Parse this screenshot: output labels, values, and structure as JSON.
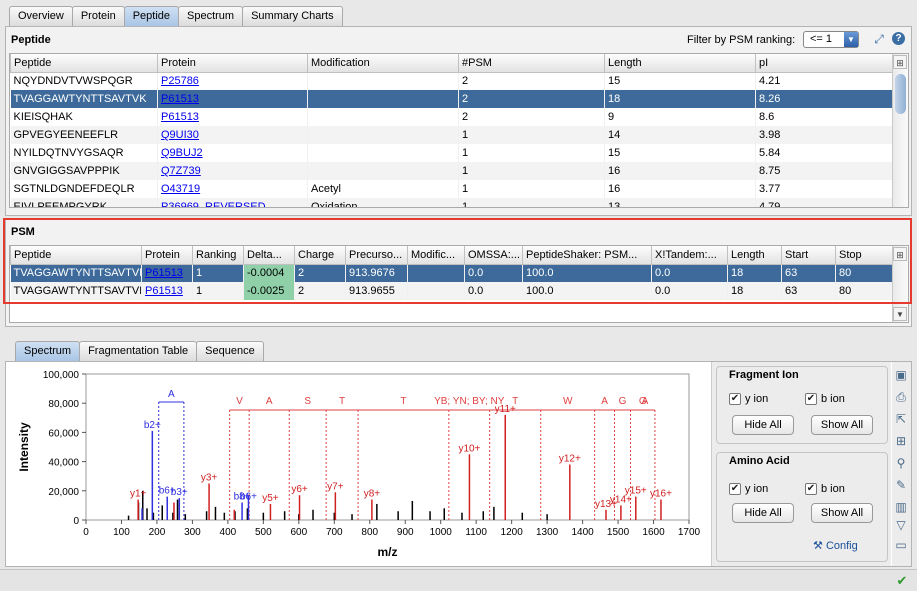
{
  "top_tabs": [
    "Overview",
    "Protein",
    "Peptide",
    "Spectrum",
    "Summary Charts"
  ],
  "peptide": {
    "title": "Peptide",
    "filter_label": "Filter by PSM ranking:",
    "filter_value": "<= 1",
    "columns": [
      "Peptide",
      "Protein",
      "Modification",
      "#PSM",
      "Length",
      "pI"
    ],
    "rows": [
      [
        "NQYDNDVTVWSPQGR",
        "P25786",
        "",
        "2",
        "15",
        "4.21"
      ],
      [
        "TVAGGAWTYNTTSAVTVK",
        "P61513",
        "",
        "2",
        "18",
        "8.26"
      ],
      [
        "KIEISQHAK",
        "P61513",
        "",
        "2",
        "9",
        "8.6"
      ],
      [
        "GPVEGYEENEEFLR",
        "Q9UI30",
        "",
        "1",
        "14",
        "3.98"
      ],
      [
        "NYILDQTNVYGSAQR",
        "Q9BUJ2",
        "",
        "1",
        "15",
        "5.84"
      ],
      [
        "GNVGIGGSAVPPPIK",
        "Q7Z739",
        "",
        "1",
        "16",
        "8.75"
      ],
      [
        "SGTNLDGNDEFDEQLR",
        "O43719",
        "Acetyl",
        "1",
        "16",
        "3.77"
      ],
      [
        "EIVLPEEMPGYRK",
        "P36969_REVERSED",
        "Oxidation",
        "1",
        "13",
        "4.79"
      ]
    ]
  },
  "psm": {
    "title": "PSM",
    "columns": [
      "Peptide",
      "Protein",
      "Ranking",
      "Delta...",
      "Charge",
      "Precurso...",
      "Modific...",
      "OMSSA:...",
      "PeptideShaker: PSM...",
      "X!Tandem:...",
      "Length",
      "Start",
      "Stop"
    ],
    "rows": [
      [
        "TVAGGAWTYNTTSAVTVK",
        "P61513",
        "1",
        "-0.0004",
        "2",
        "913.9676",
        "",
        "0.0",
        "100.0",
        "0.0",
        "18",
        "63",
        "80"
      ],
      [
        "TVAGGAWTYNTTSAVTVK",
        "P61513",
        "1",
        "-0.0025",
        "2",
        "913.9655",
        "",
        "0.0",
        "100.0",
        "0.0",
        "18",
        "63",
        "80"
      ]
    ]
  },
  "bottom_tabs": [
    "Spectrum",
    "Fragmentation Table",
    "Sequence"
  ],
  "fragment_ion": {
    "title": "Fragment Ion",
    "y_label": "y ion",
    "b_label": "b ion",
    "hide": "Hide All",
    "show": "Show All"
  },
  "amino_acid": {
    "title": "Amino Acid",
    "y_label": "y ion",
    "b_label": "b ion",
    "hide": "Hide All",
    "show": "Show All",
    "config": "Config"
  },
  "chart_data": {
    "type": "bar",
    "xlabel": "m/z",
    "ylabel": "Intensity",
    "xlim": [
      0,
      1700
    ],
    "ylim": [
      0,
      100000
    ],
    "xticks": [
      0,
      100,
      200,
      300,
      400,
      500,
      600,
      700,
      800,
      900,
      1000,
      1100,
      1200,
      1300,
      1400,
      1500,
      1600,
      1700
    ],
    "yticks": [
      0,
      20000,
      40000,
      60000,
      80000,
      100000
    ],
    "ytick_labels": [
      "0",
      "20,000",
      "40,000",
      "60,000",
      "80,000",
      "100,000"
    ],
    "series": [
      {
        "color": "#000000",
        "peaks": [
          [
            120,
            3000
          ],
          [
            148,
            12000
          ],
          [
            160,
            20000
          ],
          [
            172,
            8000
          ],
          [
            190,
            5000
          ],
          [
            215,
            10000
          ],
          [
            245,
            5000
          ],
          [
            258,
            14000
          ],
          [
            280,
            4000
          ],
          [
            340,
            6000
          ],
          [
            365,
            9000
          ],
          [
            390,
            5000
          ],
          [
            420,
            6000
          ],
          [
            455,
            8000
          ],
          [
            500,
            5000
          ],
          [
            560,
            6000
          ],
          [
            600,
            4000
          ],
          [
            640,
            7000
          ],
          [
            700,
            5000
          ],
          [
            750,
            4000
          ],
          [
            820,
            11000
          ],
          [
            880,
            6000
          ],
          [
            920,
            13000
          ],
          [
            970,
            6000
          ],
          [
            1010,
            8000
          ],
          [
            1060,
            5000
          ],
          [
            1120,
            6000
          ],
          [
            1150,
            9000
          ],
          [
            1230,
            5000
          ],
          [
            1300,
            4000
          ]
        ]
      },
      {
        "color": "#3030e0",
        "name": "b",
        "peaks": [
          [
            158,
            8000
          ],
          [
            187,
            61000
          ],
          [
            229,
            16000
          ],
          [
            263,
            15000
          ],
          [
            440,
            12000
          ],
          [
            458,
            17000
          ]
        ]
      },
      {
        "color": "#d02020",
        "name": "y",
        "peaks": [
          [
            147,
            14000
          ],
          [
            248,
            12000
          ],
          [
            347,
            25000
          ],
          [
            418,
            7000
          ],
          [
            520,
            11000
          ],
          [
            602,
            17000
          ],
          [
            703,
            19000
          ],
          [
            806,
            14000
          ],
          [
            1081,
            45000
          ],
          [
            1182,
            72000
          ],
          [
            1364,
            38000
          ],
          [
            1466,
            7000
          ],
          [
            1508,
            10000
          ],
          [
            1550,
            16000
          ],
          [
            1621,
            14000
          ]
        ]
      }
    ],
    "ion_labels": [
      {
        "text": "y1+",
        "x": 147,
        "y": 14000,
        "c": "r"
      },
      {
        "text": "b2+",
        "x": 187,
        "y": 61000,
        "c": "b"
      },
      {
        "text": "b6+",
        "x": 229,
        "y": 16000,
        "c": "b"
      },
      {
        "text": "b3+",
        "x": 263,
        "y": 15000,
        "c": "b"
      },
      {
        "text": "y3+",
        "x": 347,
        "y": 25000,
        "c": "r"
      },
      {
        "text": "b8+",
        "x": 440,
        "y": 12000,
        "c": "b"
      },
      {
        "text": "b6+",
        "x": 458,
        "y": 12000,
        "c": "b"
      },
      {
        "text": "y5+",
        "x": 520,
        "y": 11000,
        "c": "r"
      },
      {
        "text": "y6+",
        "x": 602,
        "y": 17000,
        "c": "r"
      },
      {
        "text": "y7+",
        "x": 703,
        "y": 19000,
        "c": "r"
      },
      {
        "text": "y8+",
        "x": 806,
        "y": 14000,
        "c": "r"
      },
      {
        "text": "y10+",
        "x": 1081,
        "y": 45000,
        "c": "r"
      },
      {
        "text": "y11+",
        "x": 1182,
        "y": 72000,
        "c": "r"
      },
      {
        "text": "y12+",
        "x": 1364,
        "y": 38000,
        "c": "r"
      },
      {
        "text": "y13+",
        "x": 1466,
        "y": 7000,
        "c": "r"
      },
      {
        "text": "y14+",
        "x": 1508,
        "y": 10000,
        "c": "r"
      },
      {
        "text": "y15+",
        "x": 1550,
        "y": 16000,
        "c": "r"
      },
      {
        "text": "y16+",
        "x": 1621,
        "y": 14000,
        "c": "r"
      }
    ],
    "aa_labels": [
      "V",
      "A",
      "S",
      "T",
      "T",
      "YB; YN; BY; NY",
      "T",
      "W",
      "A",
      "G",
      "G",
      "A"
    ],
    "aa_x": [
      405,
      460,
      573,
      677,
      767,
      1023,
      1138,
      1282,
      1434,
      1490,
      1535,
      1604
    ],
    "aa_blue": {
      "text": "A",
      "x": [
        205,
        276
      ]
    }
  }
}
